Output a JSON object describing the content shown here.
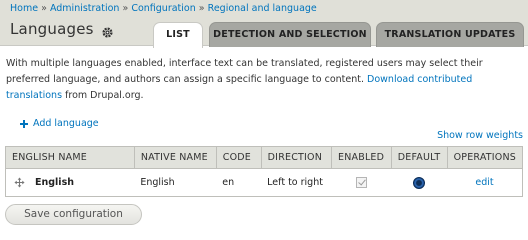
{
  "breadcrumb": {
    "items": [
      "Home",
      "Administration",
      "Configuration",
      "Regional and language"
    ],
    "separator": "»"
  },
  "page": {
    "title": "Languages"
  },
  "tabs": [
    {
      "label": "LIST",
      "active": true
    },
    {
      "label": "DETECTION AND SELECTION",
      "active": false
    },
    {
      "label": "TRANSLATION UPDATES",
      "active": false
    }
  ],
  "description": {
    "text": "With multiple languages enabled, interface text can be translated, registered users may select their preferred language, and authors can assign a specific language to content. ",
    "link": "Download contributed translations",
    "after": " from Drupal.org."
  },
  "actions": {
    "add_language": "Add language",
    "show_row_weights": "Show row weights"
  },
  "table": {
    "headers": [
      "ENGLISH NAME",
      "NATIVE NAME",
      "CODE",
      "DIRECTION",
      "ENABLED",
      "DEFAULT",
      "OPERATIONS"
    ],
    "rows": [
      {
        "english_name": "English",
        "native_name": "English",
        "code": "en",
        "direction": "Left to right",
        "enabled": true,
        "default": true,
        "operation": "edit"
      }
    ]
  },
  "form": {
    "save_label": "Save configuration"
  },
  "colors": {
    "link": "#0074bd",
    "header_bg": "#e0e0d8",
    "tab_inactive": "#a6a7a2"
  }
}
